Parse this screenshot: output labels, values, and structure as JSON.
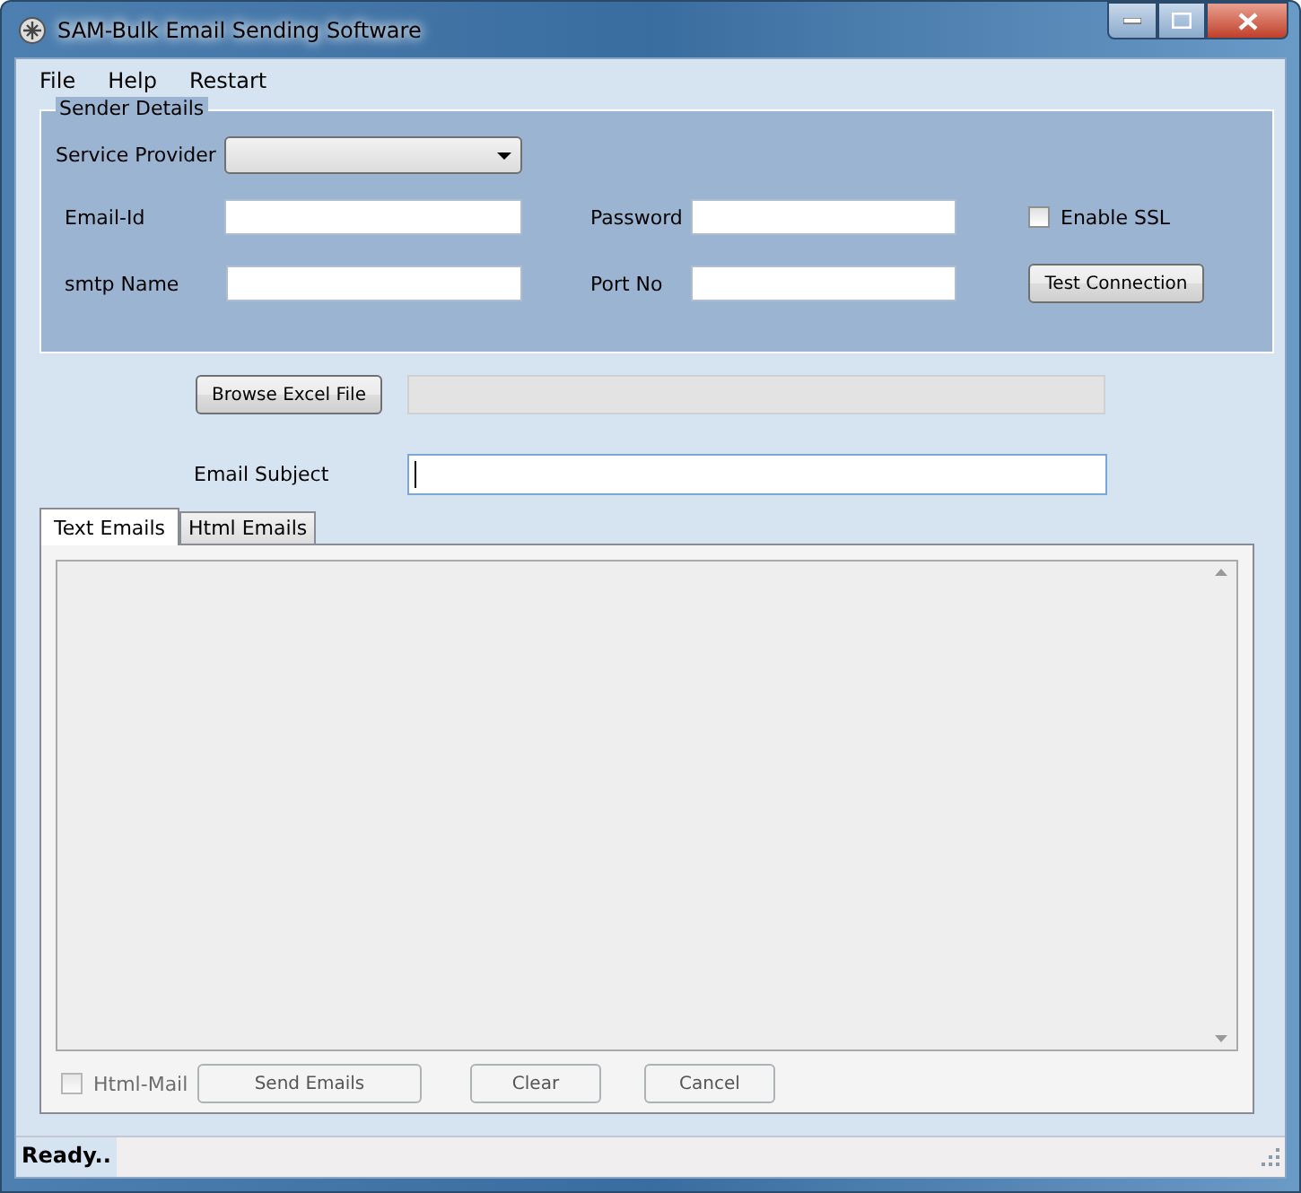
{
  "window": {
    "title": "SAM-Bulk Email Sending Software"
  },
  "menu": [
    "File",
    "Help",
    "Restart"
  ],
  "sender_details": {
    "title": "Sender Details",
    "service_provider": {
      "label": "Service Provider"
    },
    "email_id": {
      "label": "Email-Id"
    },
    "password": {
      "label": "Password"
    },
    "enable_ssl": {
      "label": "Enable SSL",
      "checked": false
    },
    "smtp_name": {
      "label": "smtp Name"
    },
    "port_no": {
      "label": "Port No"
    },
    "test_button": "Test Connection"
  },
  "browse": {
    "button": "Browse Excel File",
    "path_disabled": true
  },
  "subject": {
    "label": "Email Subject"
  },
  "tabs": [
    {
      "label": "Text Emails",
      "selected": true
    },
    {
      "label": "Html Emails",
      "selected": false
    }
  ],
  "html_mail": {
    "label": "Html-Mail",
    "checked": false,
    "disabled": true
  },
  "buttons": [
    {
      "label": "Send Emails",
      "disabled": true
    },
    {
      "label": "Clear",
      "disabled": true
    },
    {
      "label": "Cancel",
      "disabled": true
    }
  ],
  "status_bar": "Ready.."
}
